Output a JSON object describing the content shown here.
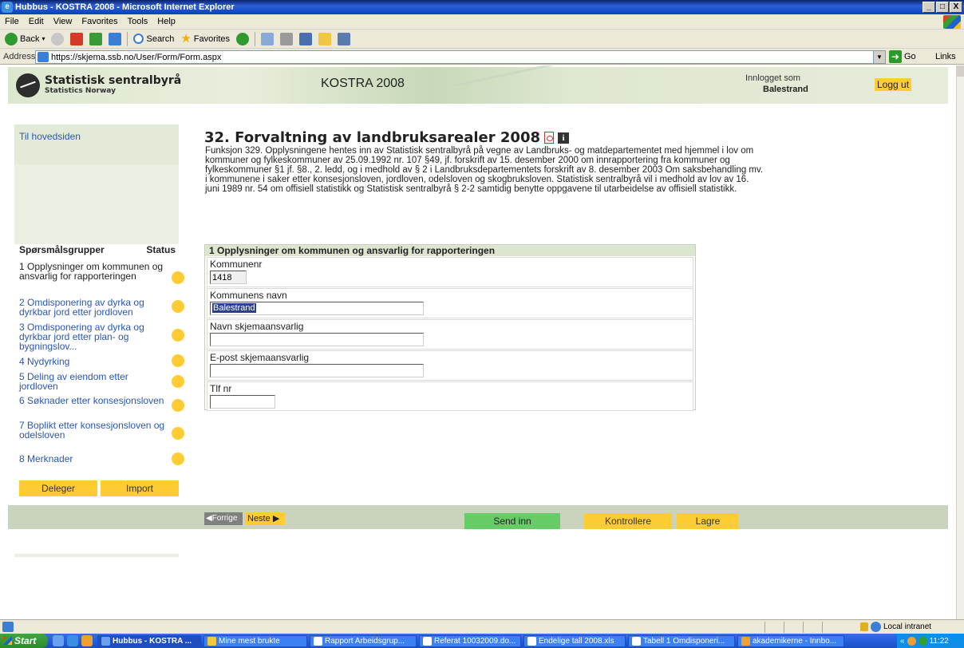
{
  "window": {
    "title": "Hubbus - KOSTRA 2008 - Microsoft Internet Explorer",
    "min": "_",
    "max": "□",
    "close": "X"
  },
  "menu": [
    "File",
    "Edit",
    "View",
    "Favorites",
    "Tools",
    "Help"
  ],
  "toolbar": {
    "back": "Back",
    "search": "Search",
    "favorites": "Favorites"
  },
  "address": {
    "label": "Address",
    "url": "https://skjema.ssb.no/User/Form/Form.aspx",
    "go": "Go",
    "links": "Links"
  },
  "banner": {
    "org_name": "Statistisk sentralbyrå",
    "org_sub": "Statistics Norway",
    "app_title": "KOSTRA 2008",
    "login_label": "Innlogget som",
    "login_user": "Balestrand",
    "logout": "Logg ut"
  },
  "nav": {
    "home": "Til hovedsiden",
    "groups_header": "Spørsmålsgrupper",
    "status_header": "Status",
    "items": [
      {
        "label": "1 Opplysninger om kommunen og ansvarlig for rapporteringen",
        "status": "yellow"
      },
      {
        "label": "2 Omdisponering av dyrka og dyrkbar jord etter jordloven",
        "status": "yellow"
      },
      {
        "label": "3 Omdisponering av dyrka og dyrkbar jord etter plan- og bygningslov...",
        "status": "yellow"
      },
      {
        "label": "4 Nydyrking",
        "status": "yellow"
      },
      {
        "label": "5 Deling av eiendom etter jordloven",
        "status": "yellow"
      },
      {
        "label": "6 Søknader etter konsesjonsloven",
        "status": "yellow"
      },
      {
        "label": "7 Boplikt etter konsesjonsloven og odelsloven",
        "status": "yellow"
      },
      {
        "label": "8 Merknader",
        "status": "yellow"
      }
    ],
    "delegate": "Deleger",
    "import": "Import"
  },
  "main": {
    "title": "32. Forvaltning av landbruksarealer 2008",
    "intro": "Funksjon 329. Opplysningene hentes inn av Statistisk sentralbyrå på vegne av Landbruks- og matdepartementet med hjemmel i lov om kommuner og fylkeskommuner av 25.09.1992 nr. 107 §49, jf. forskrift av 15. desember 2000 om innrapportering fra kommuner og fylkeskommuner §1 jf. §8., 2. ledd, og i medhold av § 2 i Landbruksdepartementets forskrift av 8. desember 2003 Om saksbehandling mv. i kommunene i saker etter konsesjonsloven, jordloven, odelsloven og skogbruksloven. Statistisk sentralbyrå vil i medhold av lov av 16. juni 1989 nr. 54 om offisiell statistikk og Statistisk sentralbyrå § 2-2 samtidig benytte oppgavene til utarbeidelse av offisiell statistikk.",
    "section_title": "1 Opplysninger om kommunen og ansvarlig for rapporteringen",
    "fields": {
      "kommunenr": {
        "label": "Kommunenr",
        "value": "1418"
      },
      "kommunenavn": {
        "label": "Kommunens navn",
        "value": "Balestrand"
      },
      "navn": {
        "label": "Navn skjemaansvarlig",
        "value": ""
      },
      "epost": {
        "label": "E-post skjemaansvarlig",
        "value": ""
      },
      "tlf": {
        "label": "Tlf nr",
        "value": ""
      }
    }
  },
  "actions": {
    "prev": "Forrige",
    "next": "Neste",
    "submit": "Send inn",
    "validate": "Kontrollere",
    "save": "Lagre"
  },
  "status": {
    "zone": "Local intranet"
  },
  "taskbar": {
    "start": "Start",
    "tasks": [
      {
        "label": "Hubbus - KOSTRA ...",
        "active": true
      },
      {
        "label": "Mine mest brukte",
        "active": false
      },
      {
        "label": "Rapport Arbeidsgrup...",
        "active": false
      },
      {
        "label": "Referat 10032009.do...",
        "active": false
      },
      {
        "label": "Endelige tall 2008.xls",
        "active": false
      },
      {
        "label": "Tabell 1 Omdisponeri...",
        "active": false
      },
      {
        "label": "akademikerne - Innbo...",
        "active": false
      }
    ],
    "clock": "11:22"
  },
  "colors": {
    "accent_yellow": "#ffcc33",
    "submit_green": "#66cc66",
    "link_blue": "#2a56b8",
    "panel_green": "#eaf0e2"
  }
}
